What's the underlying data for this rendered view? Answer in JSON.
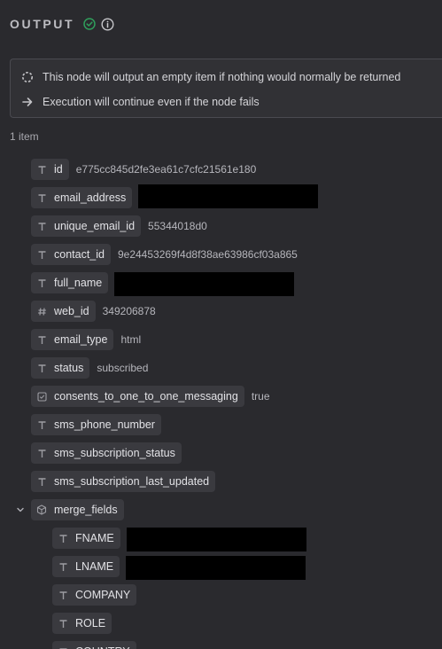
{
  "output": {
    "title": "OUTPUT",
    "status_color": "#2f9e5b",
    "check_icon": "check-circle-icon",
    "info_icon": "info-circle-icon"
  },
  "notices": [
    {
      "icon": "dotted-circle-icon",
      "text": "This node will output an empty item if nothing would normally be returned"
    },
    {
      "icon": "arrow-right-icon",
      "text": "Execution will continue even if the node fails"
    }
  ],
  "item_count": "1 item",
  "fields": [
    {
      "key": "id",
      "type": "string",
      "value": "e775cc845d2fe3ea61c7cfc21561e180"
    },
    {
      "key": "email_address",
      "type": "string",
      "value": null,
      "redacted": true
    },
    {
      "key": "unique_email_id",
      "type": "string",
      "value": "55344018d0"
    },
    {
      "key": "contact_id",
      "type": "string",
      "value": "9e24453269f4d8f38ae63986cf03a865"
    },
    {
      "key": "full_name",
      "type": "string",
      "value": null,
      "redacted": true
    },
    {
      "key": "web_id",
      "type": "number",
      "value": "349206878"
    },
    {
      "key": "email_type",
      "type": "string",
      "value": "html"
    },
    {
      "key": "status",
      "type": "string",
      "value": "subscribed"
    },
    {
      "key": "consents_to_one_to_one_messaging",
      "type": "boolean",
      "value": "true"
    },
    {
      "key": "sms_phone_number",
      "type": "string",
      "value": ""
    },
    {
      "key": "sms_subscription_status",
      "type": "string",
      "value": ""
    },
    {
      "key": "sms_subscription_last_updated",
      "type": "string",
      "value": ""
    },
    {
      "key": "merge_fields",
      "type": "object",
      "value": null,
      "expanded": true
    },
    {
      "key": "FNAME",
      "type": "string",
      "value": null,
      "redacted": true,
      "child": true
    },
    {
      "key": "LNAME",
      "type": "string",
      "value": null,
      "redacted": true,
      "child": true
    },
    {
      "key": "COMPANY",
      "type": "string",
      "value": "",
      "child": true
    },
    {
      "key": "ROLE",
      "type": "string",
      "value": "",
      "child": true
    },
    {
      "key": "COUNTRY",
      "type": "string",
      "value": "",
      "child": true
    }
  ]
}
